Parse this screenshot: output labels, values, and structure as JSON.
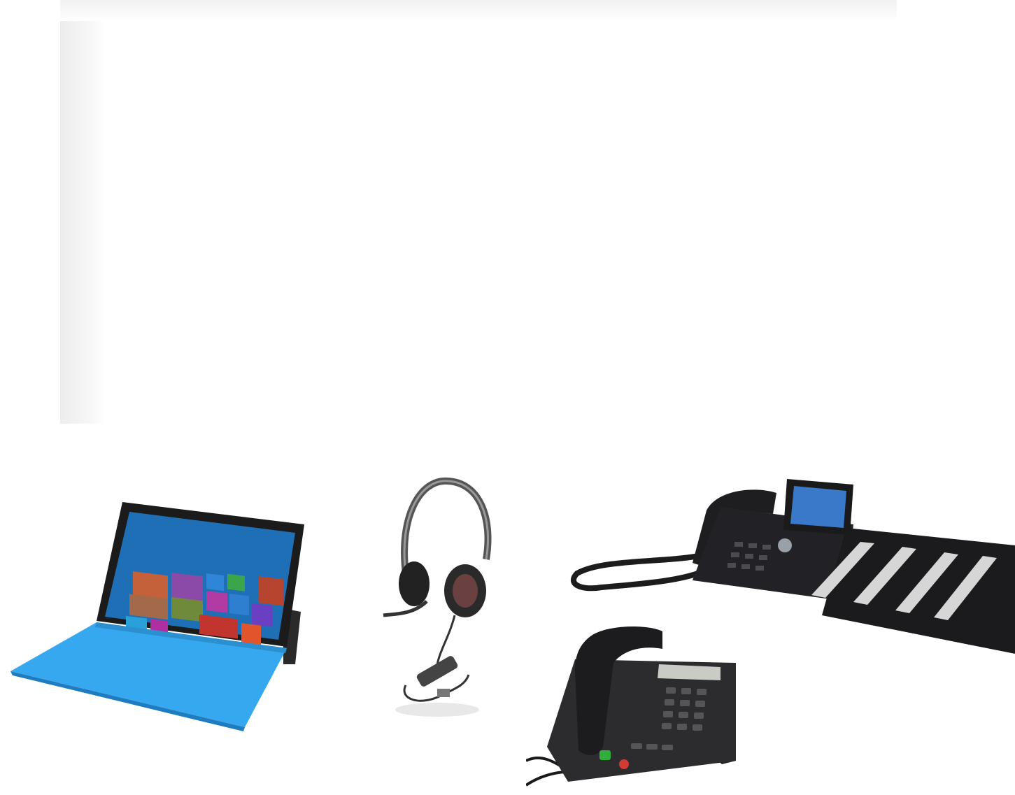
{
  "background_panel": {
    "color": "#ffffff",
    "edge_shade": "#ededed"
  },
  "photos": [
    {
      "name": "surface-tablet",
      "keyboard_color": "#35a8f0",
      "screen_color": "#1e6fb5"
    },
    {
      "name": "usb-headset",
      "color": "#2a2a2a"
    },
    {
      "name": "ip-desk-phone-with-expansion-modules",
      "color": "#1f1f22",
      "display_color": "#3a78c9"
    },
    {
      "name": "desk-phone-handset",
      "color": "#2c2c2e",
      "accent_green": "#2fae3e",
      "accent_red": "#d23b32"
    }
  ]
}
